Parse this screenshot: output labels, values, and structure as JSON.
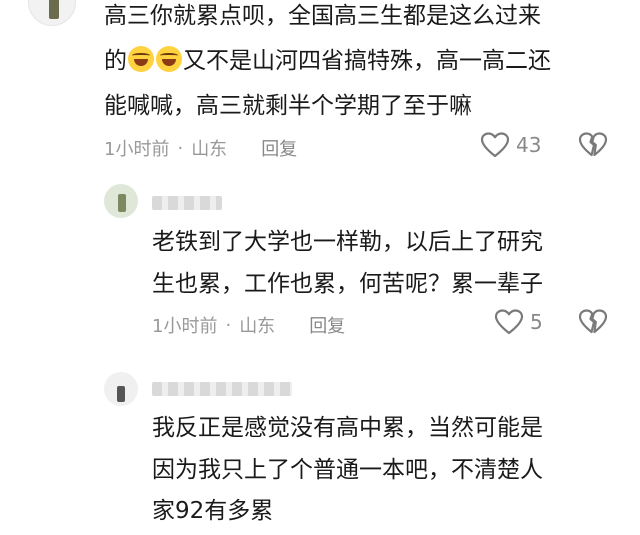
{
  "main_comment": {
    "lines": [
      "高三你就累点呗，全国高三生都是这么过来",
      "又不是山河四省搞特殊，高一高二还",
      "能喊喊，高三就剩半个学期了至于嘛"
    ],
    "line2_prefix": "的",
    "emoji_icon": "laughing-crying-emoji",
    "time": "1小时前",
    "separator": "·",
    "location": "山东",
    "reply_label": "回复",
    "likes": "43",
    "like_icon": "heart-outline-icon",
    "dislike_icon": "broken-heart-icon"
  },
  "replies": [
    {
      "lines": [
        "老铁到了大学也一样勒，以后上了研究",
        "生也累，工作也累，何苦呢？累一辈子"
      ],
      "time": "1小时前",
      "separator": "·",
      "location": "山东",
      "reply_label": "回复",
      "likes": "5"
    },
    {
      "lines": [
        "我反正是感觉没有高中累，当然可能是",
        "因为我只上了个普通一本吧，不清楚人",
        "家92有多累"
      ]
    }
  ],
  "colors": {
    "text": "#1a1a1a",
    "meta": "#999999",
    "icon": "#888888",
    "emoji": "#ffd23f"
  }
}
